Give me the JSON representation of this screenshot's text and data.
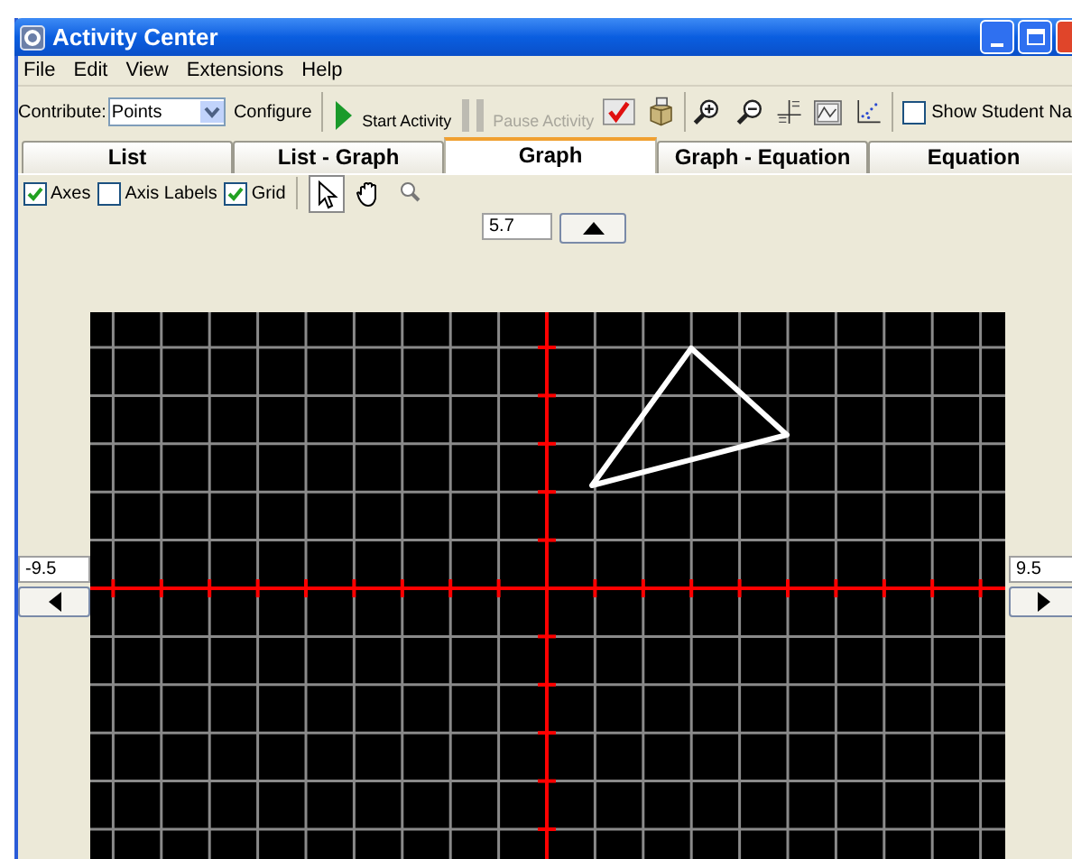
{
  "window": {
    "title": "Activity Center"
  },
  "menu": [
    "File",
    "Edit",
    "View",
    "Extensions",
    "Help"
  ],
  "toolbar": {
    "contribute_label": "Contribute:",
    "contribute_value": "Points",
    "configure": "Configure",
    "start": {
      "label": "Start Activity",
      "disabled": false
    },
    "pause": {
      "label": "Pause Activity",
      "disabled": true
    },
    "show_student_names": {
      "label": "Show Student Na",
      "checked": false
    }
  },
  "tabs": [
    {
      "label": "List",
      "selected": false
    },
    {
      "label": "List - Graph",
      "selected": false
    },
    {
      "label": "Graph",
      "selected": true
    },
    {
      "label": "Graph - Equation",
      "selected": false
    },
    {
      "label": "Equation",
      "selected": false
    }
  ],
  "graph_options": [
    {
      "label": "Axes",
      "checked": true
    },
    {
      "label": "Axis Labels",
      "checked": false
    },
    {
      "label": "Grid",
      "checked": true
    }
  ],
  "graph_tools": [
    {
      "kind": "pointer",
      "selected": true
    },
    {
      "kind": "hand",
      "selected": false
    },
    {
      "kind": "zoom",
      "selected": false
    }
  ],
  "window_range": {
    "ymax": "5.7",
    "xmin": "-9.5",
    "xmax": "9.5"
  }
}
